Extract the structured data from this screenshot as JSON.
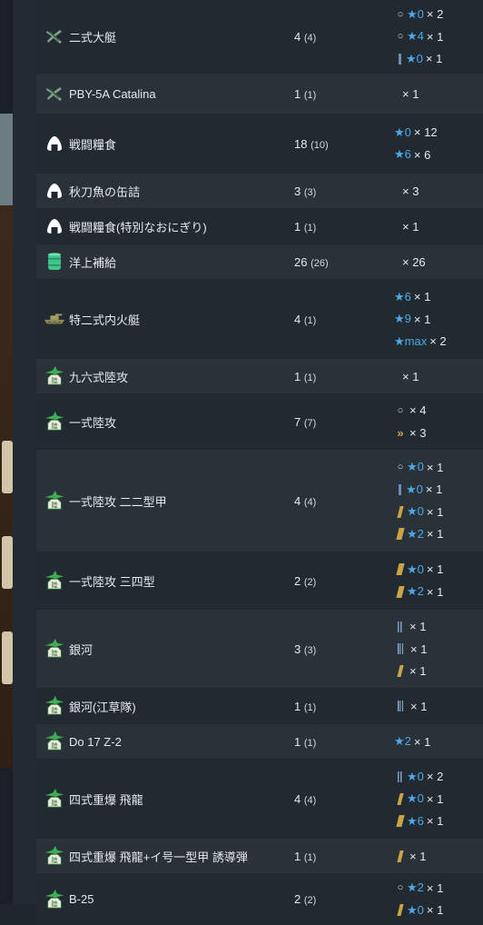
{
  "rows": [
    {
      "icon": "plane-x-icon",
      "name": "二式大艇",
      "count": "4",
      "count_sub": "(4)",
      "impr": [
        {
          "mark": "circle",
          "star": "★0",
          "x": "× 2"
        },
        {
          "mark": "circle",
          "star": "★4",
          "x": "× 1"
        },
        {
          "mark": "bar1",
          "star": "★0",
          "x": "× 1"
        }
      ]
    },
    {
      "icon": "plane-x-icon",
      "name": "PBY-5A Catalina",
      "count": "1",
      "count_sub": "(1)",
      "impr": [
        {
          "mark": "",
          "star": "",
          "x": "× 1",
          "indent": true
        }
      ]
    },
    {
      "icon": "rice-ball-icon",
      "name": "戦闘糧食",
      "count": "18",
      "count_sub": "(10)",
      "impr": [
        {
          "mark": "",
          "star": "★0",
          "x": "× 12"
        },
        {
          "mark": "",
          "star": "★6",
          "x": "× 6"
        }
      ]
    },
    {
      "icon": "rice-ball-icon",
      "name": "秋刀魚の缶詰",
      "count": "3",
      "count_sub": "(3)",
      "impr": [
        {
          "mark": "",
          "star": "",
          "x": "× 3",
          "indent": true
        }
      ]
    },
    {
      "icon": "rice-ball-icon",
      "name": "戦闘糧食(特別なおにぎり)",
      "count": "1",
      "count_sub": "(1)",
      "impr": [
        {
          "mark": "",
          "star": "",
          "x": "× 1",
          "indent": true
        }
      ]
    },
    {
      "icon": "drum-icon",
      "name": "洋上補給",
      "count": "26",
      "count_sub": "(26)",
      "impr": [
        {
          "mark": "",
          "star": "",
          "x": "× 26",
          "indent": true
        }
      ]
    },
    {
      "icon": "landing-craft-icon",
      "name": "特二式内火艇",
      "count": "4",
      "count_sub": "(1)",
      "impr": [
        {
          "mark": "",
          "star": "★6",
          "x": "× 1"
        },
        {
          "mark": "",
          "star": "★9",
          "x": "× 1"
        },
        {
          "mark": "",
          "star": "★max",
          "x": "× 2"
        }
      ]
    },
    {
      "icon": "land-bomber-icon",
      "name": "九六式陸攻",
      "count": "1",
      "count_sub": "(1)",
      "impr": [
        {
          "mark": "",
          "star": "",
          "x": "× 1",
          "indent": true
        }
      ]
    },
    {
      "icon": "land-bomber-icon",
      "name": "一式陸攻",
      "count": "7",
      "count_sub": "(7)",
      "impr": [
        {
          "mark": "circle",
          "star": "",
          "x": "× 4"
        },
        {
          "mark": "chev",
          "star": "",
          "x": "× 3"
        }
      ]
    },
    {
      "icon": "land-bomber-icon",
      "name": "一式陸攻 二二型甲",
      "count": "4",
      "count_sub": "(4)",
      "impr": [
        {
          "mark": "circle",
          "star": "★0",
          "x": "× 1"
        },
        {
          "mark": "bar1",
          "star": "★0",
          "x": "× 1"
        },
        {
          "mark": "slash1",
          "star": "★0",
          "x": "× 1"
        },
        {
          "mark": "slash2",
          "star": "★2",
          "x": "× 1"
        }
      ]
    },
    {
      "icon": "land-bomber-icon",
      "name": "一式陸攻 三四型",
      "count": "2",
      "count_sub": "(2)",
      "impr": [
        {
          "mark": "slash2",
          "star": "★0",
          "x": "× 1"
        },
        {
          "mark": "slash2",
          "star": "★2",
          "x": "× 1"
        }
      ]
    },
    {
      "icon": "land-bomber-icon",
      "name": "銀河",
      "count": "3",
      "count_sub": "(3)",
      "impr": [
        {
          "mark": "bar2",
          "star": "",
          "x": "× 1"
        },
        {
          "mark": "bar3",
          "star": "",
          "x": "× 1"
        },
        {
          "mark": "slash1",
          "star": "",
          "x": "× 1"
        }
      ]
    },
    {
      "icon": "land-bomber-icon",
      "name": "銀河(江草隊)",
      "count": "1",
      "count_sub": "(1)",
      "impr": [
        {
          "mark": "bar3",
          "star": "",
          "x": "× 1"
        }
      ]
    },
    {
      "icon": "land-bomber-icon",
      "name": "Do 17 Z-2",
      "count": "1",
      "count_sub": "(1)",
      "impr": [
        {
          "mark": "",
          "star": "★2",
          "x": "× 1"
        }
      ]
    },
    {
      "icon": "land-bomber-icon",
      "name": "四式重爆 飛龍",
      "count": "4",
      "count_sub": "(4)",
      "impr": [
        {
          "mark": "bar2",
          "star": "★0",
          "x": "× 2"
        },
        {
          "mark": "slash1",
          "star": "★0",
          "x": "× 1"
        },
        {
          "mark": "slash2",
          "star": "★6",
          "x": "× 1"
        }
      ]
    },
    {
      "icon": "land-bomber-icon",
      "name": "四式重爆 飛龍+イ号一型甲 誘導弾",
      "count": "1",
      "count_sub": "(1)",
      "impr": [
        {
          "mark": "slash1",
          "star": "",
          "x": "× 1"
        }
      ]
    },
    {
      "icon": "land-bomber-icon",
      "name": "B-25",
      "count": "2",
      "count_sub": "(2)",
      "impr": [
        {
          "mark": "circle",
          "star": "★2",
          "x": "× 1"
        },
        {
          "mark": "slash1",
          "star": "★0",
          "x": "× 1"
        }
      ]
    }
  ],
  "icon_label_land": "陸",
  "colors": {
    "star": "#4ea8e8",
    "row_odd": "#293239",
    "row_even": "#212a31",
    "gold": "#c9a447"
  }
}
